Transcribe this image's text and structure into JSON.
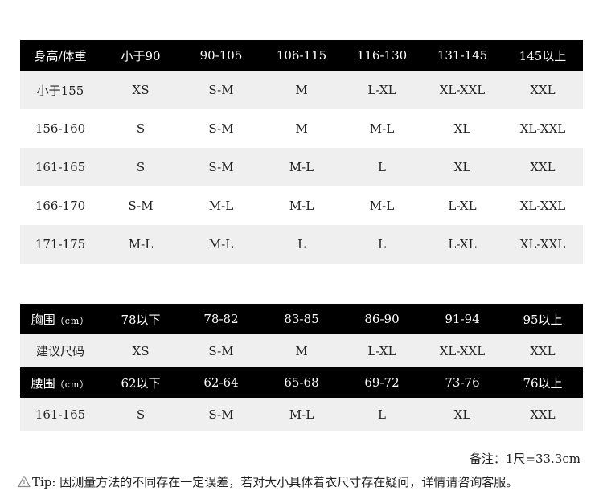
{
  "size_table": {
    "header": [
      "身高/体重",
      "小于90",
      "90-105",
      "106-115",
      "116-130",
      "131-145",
      "145以上"
    ],
    "rows": [
      [
        "小于155",
        "XS",
        "S-M",
        "M",
        "L-XL",
        "XL-XXL",
        "XXL"
      ],
      [
        "156-160",
        "S",
        "S-M",
        "M",
        "M-L",
        "XL",
        "XL-XXL"
      ],
      [
        "161-165",
        "S",
        "S-M",
        "M-L",
        "L",
        "XL",
        "XXL"
      ],
      [
        "166-170",
        "S-M",
        "M-L",
        "M-L",
        "M-L",
        "L-XL",
        "XL-XXL"
      ],
      [
        "171-175",
        "M-L",
        "M-L",
        "L",
        "L",
        "L-XL",
        "XL-XXL"
      ]
    ]
  },
  "measure_table": {
    "chest_label": "胸围",
    "waist_label": "腰围",
    "unit": "（cm）",
    "chest_values": [
      "78以下",
      "78-82",
      "83-85",
      "86-90",
      "91-94",
      "95以上"
    ],
    "suggest_label": "建议尺码",
    "suggest_values": [
      "XS",
      "S-M",
      "M",
      "L-XL",
      "XL-XXL",
      "XXL"
    ],
    "waist_values": [
      "62以下",
      "62-64",
      "65-68",
      "69-72",
      "73-76",
      "76以上"
    ],
    "waist_size_label": "161-165",
    "waist_size_values": [
      "S",
      "S-M",
      "M-L",
      "L",
      "XL",
      "XXL"
    ]
  },
  "note": "备注：1尺=33.3cm",
  "tip": {
    "icon": "warning-icon",
    "label": "Tip:",
    "text": "因测量方法的不同存在一定误差，若对大小具体着衣尺寸存在疑问，详情请咨询客服。"
  }
}
